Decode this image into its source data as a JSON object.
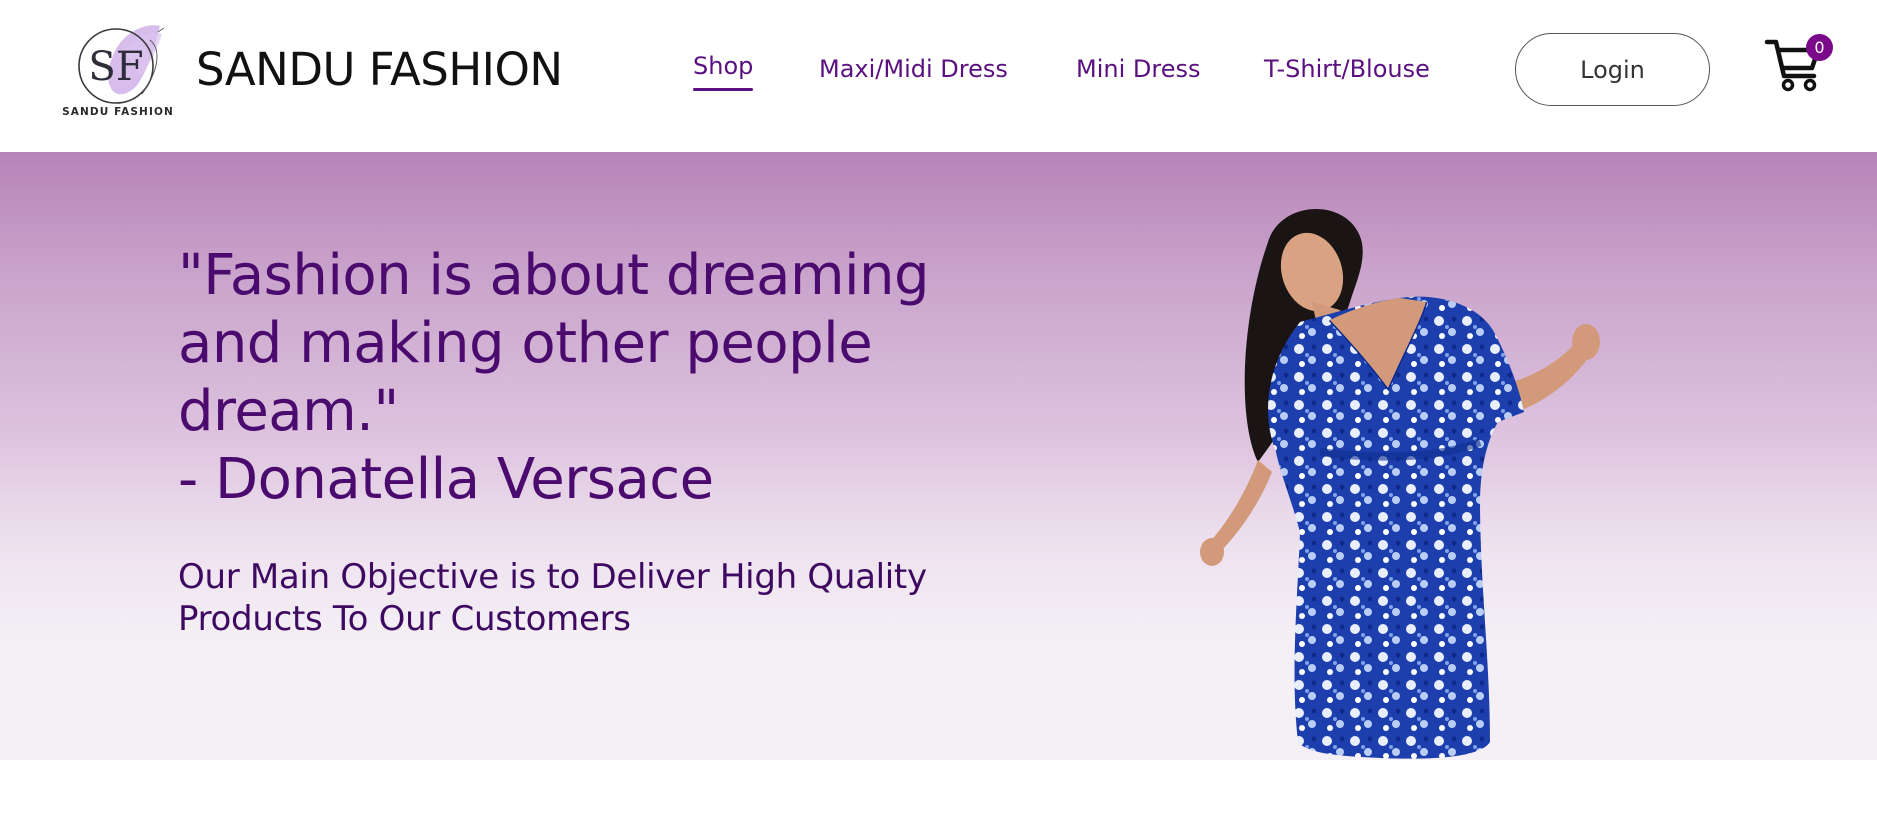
{
  "brand": {
    "logo_monogram": "SF",
    "logo_caption": "SANDU FASHION",
    "name": "SANDU FASHION"
  },
  "nav": {
    "items": [
      {
        "label": "Shop",
        "active": true
      },
      {
        "label": "Maxi/Midi Dress",
        "active": false
      },
      {
        "label": "Mini Dress",
        "active": false
      },
      {
        "label": "T-Shirt/Blouse",
        "active": false
      }
    ],
    "login_label": "Login",
    "cart_count": "0",
    "cart_icon": "shopping-cart-icon"
  },
  "hero": {
    "quote_lines": [
      "\"Fashion is about dreaming",
      "and making other people",
      "dream.\"",
      "- Donatella Versace"
    ],
    "tagline_lines": [
      "Our Main Objective is to Deliver High Quality",
      "Products To Our Customers"
    ],
    "image": "model-in-blue-floral-wrap-dress"
  },
  "colors": {
    "accent_purple": "#5a1080",
    "heading_purple": "#4b0a6e",
    "badge_purple": "#7a0a8a",
    "hero_gradient_top": "#b884b8",
    "hero_gradient_bottom": "#f5f0f5"
  }
}
